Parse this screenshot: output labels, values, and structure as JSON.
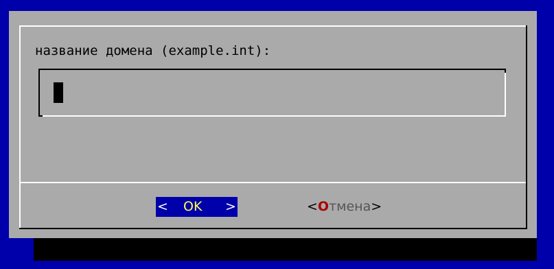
{
  "dialog": {
    "prompt": "название домена (example.int):",
    "input_value": "",
    "buttons": {
      "ok": {
        "left_bracket": "<",
        "label": "OK",
        "right_bracket": ">"
      },
      "cancel": {
        "left_bracket": "<",
        "hotkey": "О",
        "rest": "тмена",
        "right_bracket": ">"
      }
    }
  },
  "colors": {
    "background": "#0000aa",
    "dialog": "#aaaaaa",
    "selected_button": "#0000aa",
    "hotkey": "#aa0000"
  }
}
